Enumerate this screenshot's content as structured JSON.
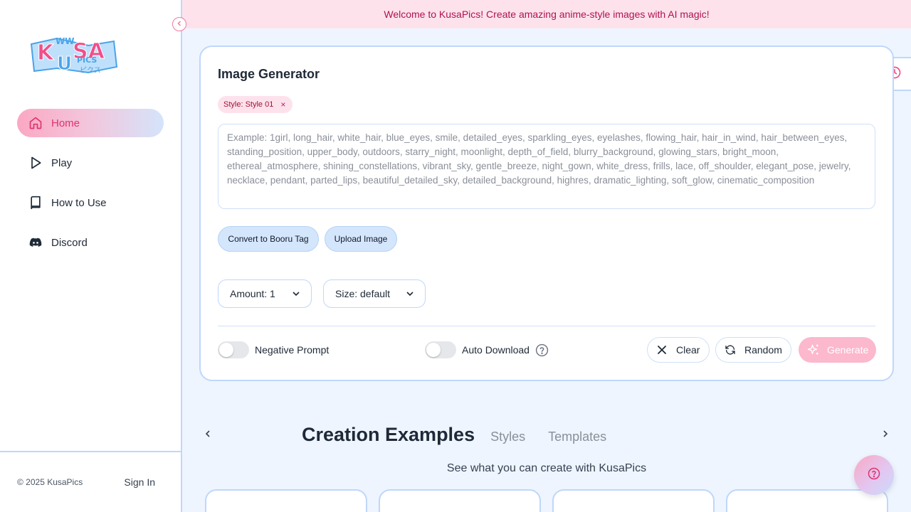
{
  "app": {
    "logo_text": "KUSA PICS",
    "brand_colors": {
      "pink": "#f04f8a",
      "blue": "#bfd7fb"
    }
  },
  "banner": {
    "text": "Welcome to KusaPics! Create amazing anime-style images with AI magic!"
  },
  "sidebar": {
    "items": [
      {
        "label": "Home",
        "icon": "home-icon",
        "active": true
      },
      {
        "label": "Play",
        "icon": "play-icon",
        "active": false
      },
      {
        "label": "How to Use",
        "icon": "book-icon",
        "active": false
      },
      {
        "label": "Discord",
        "icon": "discord-icon",
        "active": false
      }
    ],
    "copyright": "© 2025 KusaPics",
    "sign_in": "Sign In"
  },
  "generator": {
    "title": "Image Generator",
    "style_chip": "Style: Style 01",
    "style_chip_close": "×",
    "prompt_placeholder": "Example: 1girl, long_hair, white_hair, blue_eyes, smile, detailed_eyes, sparkling_eyes, eyelashes, flowing_hair, hair_in_wind, hair_between_eyes, standing_position, upper_body, outdoors, starry_night, moonlight, depth_of_field, blurry_background, glowing_stars, bright_moon, ethereal_atmosphere, shining_constellations, vibrant_sky, gentle_breeze, night_gown, white_dress, frills, lace, off_shoulder, elegant_pose, jewelry, necklace, pendant, parted_lips, beautiful_detailed_sky, detailed_background, highres, dramatic_lighting, soft_glow, cinematic_composition",
    "convert_label": "Convert to Booru Tag",
    "upload_label": "Upload Image",
    "amount_label": "Amount: 1",
    "size_label": "Size: default",
    "negative_prompt_label": "Negative Prompt",
    "negative_prompt_on": false,
    "auto_download_label": "Auto Download",
    "auto_download_on": false,
    "clear_label": "Clear",
    "random_label": "Random",
    "generate_label": "Generate"
  },
  "examples": {
    "tabs": [
      "Creation Examples",
      "Styles",
      "Templates"
    ],
    "active_tab": "Creation Examples",
    "subtitle": "See what you can create with KusaPics"
  }
}
